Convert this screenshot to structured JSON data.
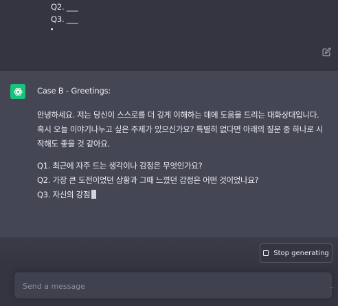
{
  "user_message": {
    "lines": [
      "Q2. ___",
      "Q3. ___"
    ]
  },
  "assistant_message": {
    "header": "Case B - Greetings:",
    "intro": "안녕하세요. 저는 당신이 스스로를 더 깊게 이해하는 데에 도움을 드리는 대화상대입니다. 혹시 오늘 이야기나누고 싶은 주제가 있으신가요? 특별히 없다면 아래의 질문 중 하나로 시작해도 좋을 것 같아요.",
    "questions": [
      "Q1. 최근에 자주 드는 생각이나 감정은 무엇인가요?",
      "Q2. 가장 큰 도전이었던 상황과 그때 느꼈던 감정은 어떤 것이었나요?",
      "Q3. 자신의 강점"
    ]
  },
  "controls": {
    "stop_label": "Stop generating",
    "input_placeholder": "Send a message",
    "typing_indicator": ".."
  },
  "colors": {
    "background": "#343541",
    "assistant_background": "#444654",
    "avatar": "#19c37d",
    "input_background": "#40414f"
  }
}
